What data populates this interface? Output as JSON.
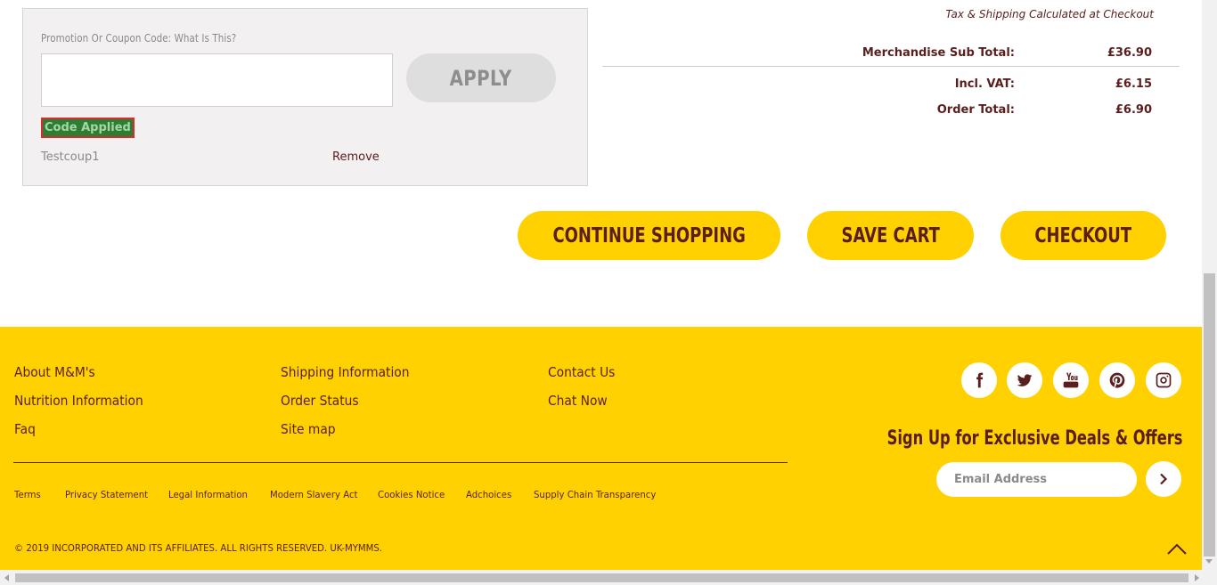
{
  "coupon": {
    "label": "Promotion Or Coupon Code: What Is This?",
    "input_value": "",
    "apply_label": "APPLY",
    "status": "Code Applied",
    "applied_code": "Testcoup1",
    "remove_label": "Remove"
  },
  "summary": {
    "tax_note": "Tax & Shipping Calculated at Checkout",
    "rows": [
      {
        "label": "Merchandise Sub Total:",
        "value": "£36.90"
      },
      {
        "label": "Incl. VAT:",
        "value": "£6.15"
      },
      {
        "label": "Order Total:",
        "value": "£6.90"
      }
    ]
  },
  "actions": {
    "continue": "CONTINUE SHOPPING",
    "save": "SAVE CART",
    "checkout": "CHECKOUT"
  },
  "footer": {
    "background": "#ffd100",
    "text_color": "#5a1e1e",
    "col1": [
      "About M&M's",
      "Nutrition Information",
      "Faq"
    ],
    "col2": [
      "Shipping Information",
      "Order Status",
      "Site map"
    ],
    "col3": [
      "Contact Us",
      "Chat Now"
    ],
    "legal": [
      "Terms",
      "Privacy Statement",
      "Legal Information",
      "Modern Slavery Act",
      "Cookies Notice",
      "Adchoices",
      "Supply Chain Transparency"
    ],
    "copyright": "© 2019  INCORPORATED AND ITS AFFILIATES. ALL RIGHTS RESERVED.  UK-MYMMS.",
    "social": [
      "facebook-icon",
      "twitter-icon",
      "youtube-icon",
      "pinterest-icon",
      "instagram-icon"
    ],
    "signup_heading": "Sign Up for Exclusive Deals & Offers",
    "email_placeholder": "Email Address"
  }
}
